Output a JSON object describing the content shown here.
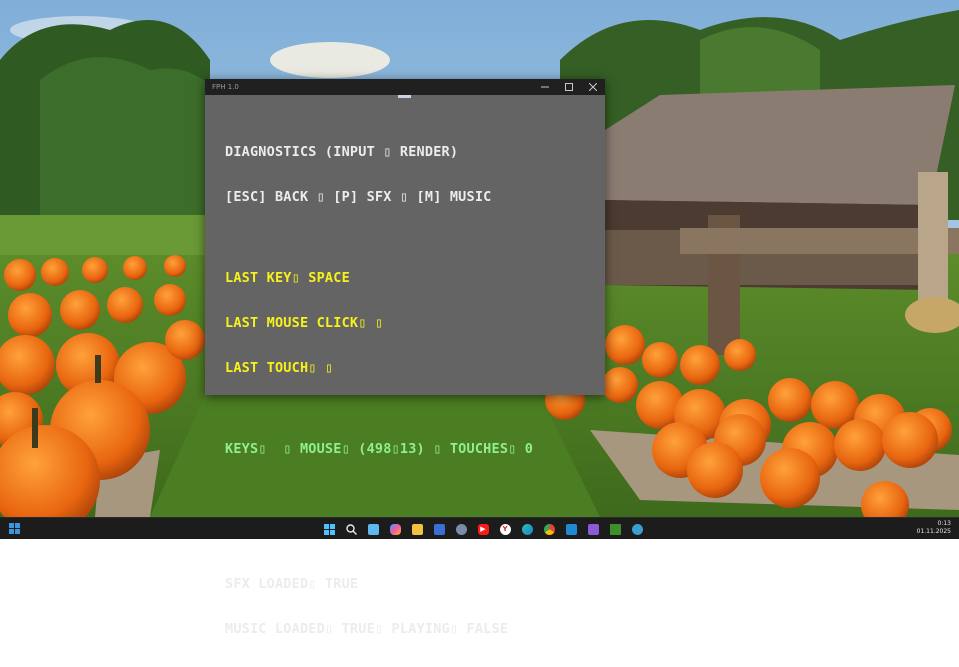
{
  "window": {
    "title": "FPH 1.0",
    "minimize_icon": "minimize-icon",
    "maximize_icon": "maximize-icon",
    "close_icon": "close-icon"
  },
  "diagnostics": {
    "heading": "DIAGNOSTICS (INPUT ▯ RENDER)",
    "controls_hint": "[ESC] BACK ▯ [P] SFX ▯ [M] MUSIC",
    "last_key": "LAST KEY▯ SPACE",
    "last_mouse_click": "LAST MOUSE CLICK▯ ▯",
    "last_touch": "LAST TOUCH▯ ▯",
    "input_summary": "KEYS▯  ▯ MOUSE▯ (498▯13) ▯ TOUCHES▯ 0",
    "sfx_status": "SFX LOADED▯ TRUE",
    "music_status": "MUSIC LOADED▯ TRUE▯ PLAYING▯ FALSE"
  },
  "colors": {
    "window_bg": "#646464",
    "text_white": "#ececec",
    "text_yellow": "#f7f21a",
    "text_green": "#8ff08f",
    "taskbar_bg": "#1c1c1c"
  },
  "taskbar": {
    "apps": [
      {
        "icon": "start-menu-icon"
      },
      {
        "icon": "search-icon"
      },
      {
        "icon": "notepad-icon"
      },
      {
        "icon": "copilot-icon"
      },
      {
        "icon": "file-explorer-icon"
      },
      {
        "icon": "save-disk-icon"
      },
      {
        "icon": "settings-cube-icon"
      },
      {
        "icon": "youtube-icon"
      },
      {
        "icon": "yandex-browser-icon"
      },
      {
        "icon": "edge-browser-icon"
      },
      {
        "icon": "chrome-browser-icon"
      },
      {
        "icon": "vscode-icon"
      },
      {
        "icon": "visual-studio-icon"
      },
      {
        "icon": "minecraft-icon"
      },
      {
        "icon": "globe-app-icon"
      }
    ],
    "time": "0:13",
    "date": "01.11.2025"
  }
}
